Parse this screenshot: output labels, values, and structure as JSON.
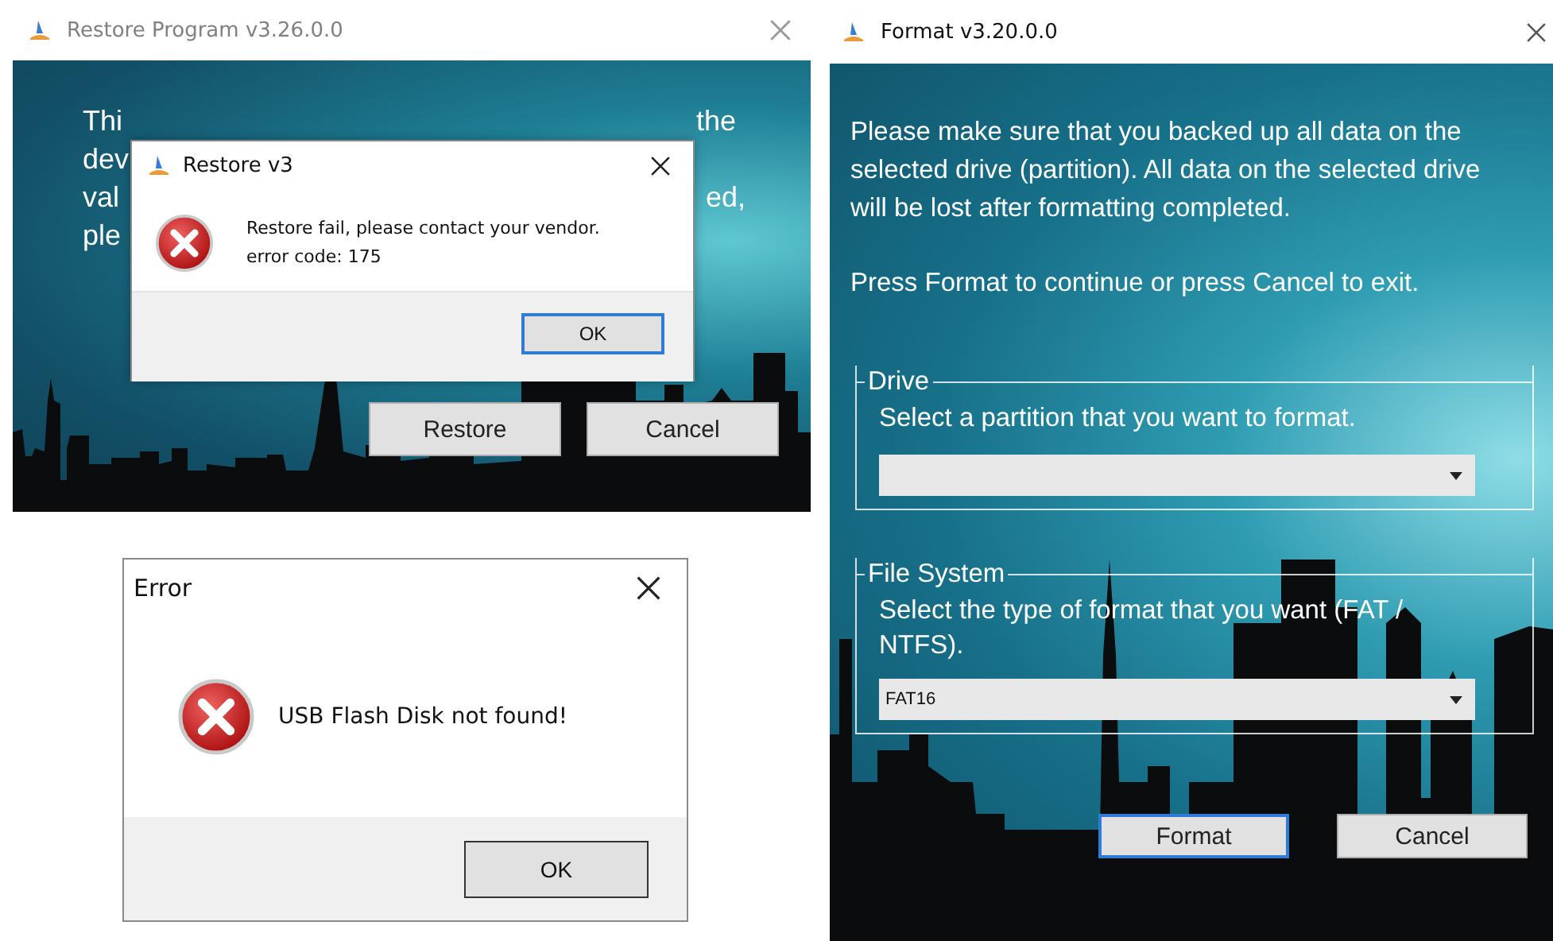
{
  "restore_window": {
    "title": "Restore Program v3.26.0.0",
    "left_fragments": [
      "Thi",
      "dev",
      "val",
      "ple"
    ],
    "right_fragments": [
      "the",
      "ed,"
    ],
    "buttons": [
      {
        "label": "Restore",
        "focused": false
      },
      {
        "label": "Cancel",
        "focused": false
      }
    ],
    "dialog": {
      "title": "Restore v3",
      "message_lines": [
        "Restore fail, please contact your vendor.",
        "error code: 175"
      ],
      "button": {
        "label": "OK",
        "focused": true
      }
    }
  },
  "error_dialog": {
    "title": "Error",
    "message": "USB Flash Disk not found!",
    "button": {
      "label": "OK",
      "focused": false
    }
  },
  "format_window": {
    "title": "Format v3.20.0.0",
    "intro": "Please make sure that you backed up all data on the selected drive (partition).  All data on the selected drive will be lost after formatting completed.",
    "instruction": "Press Format to continue or press Cancel to exit.",
    "groups": [
      {
        "legend": "Drive",
        "hint": "Select a partition that you want to format."
      },
      {
        "legend": "File System",
        "hint": "Select the type of format that you want (FAT / NTFS).",
        "dropdown": {
          "value": "FAT16"
        }
      }
    ],
    "buttons": [
      {
        "label": "Format",
        "focused": true
      },
      {
        "label": "Cancel",
        "focused": false
      }
    ]
  }
}
